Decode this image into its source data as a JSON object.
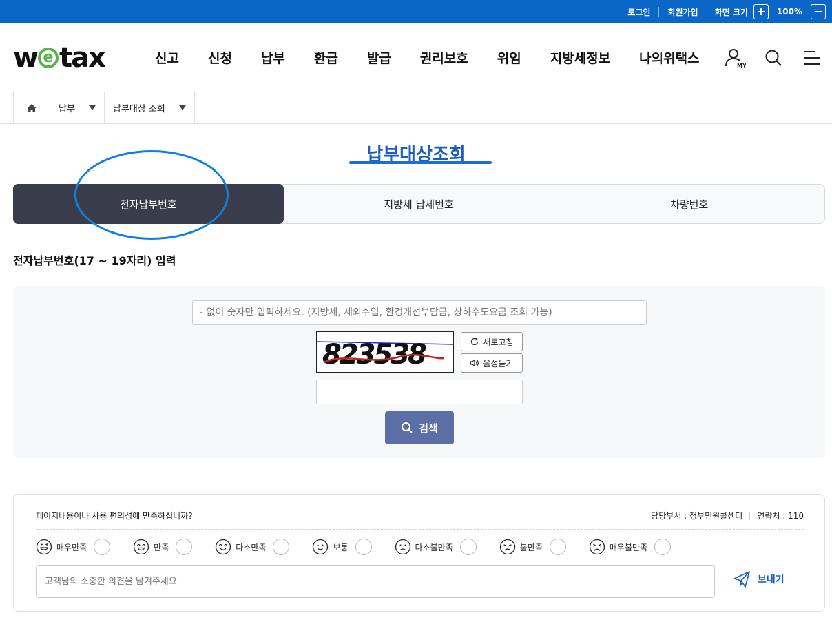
{
  "topbar": {
    "login": "로그인",
    "signup": "회원가입",
    "zoom_label": "화면 크기",
    "zoom_value": "100%",
    "zoom_in": "+",
    "zoom_out": "−"
  },
  "header": {
    "logo_w": "w",
    "logo_e": "e",
    "logo_rest": "tax",
    "nav": [
      "신고",
      "신청",
      "납부",
      "환급",
      "발급",
      "권리보호",
      "위임",
      "지방세정보",
      "나의위택스"
    ],
    "my_label": "MY"
  },
  "breadcrumb": {
    "level1": "납부",
    "level2": "납부대상 조회"
  },
  "page": {
    "title": "납부대상조회",
    "tabs": [
      "전자납부번호",
      "지방세 납세번호",
      "차량번호"
    ],
    "active_tab": 0,
    "subheading": "전자납부번호(17 ~ 19자리) 입력"
  },
  "form": {
    "number_placeholder": "- 없이 숫자만 입력하세요. (지방세, 세외수입, 환경개선부담금, 상하수도요금 조회 가능)",
    "captcha_text": "823538",
    "refresh_label": "새로고침",
    "audio_label": "음성듣기",
    "search_label": "검색"
  },
  "survey": {
    "question": "페이지내용이나 사용 편의성에 만족하십니까?",
    "dept": "담당부서 : 정부민원콜센터",
    "contact": "연락처 : 110",
    "ratings": [
      "매우만족",
      "만족",
      "다소만족",
      "보통",
      "다소불만족",
      "불만족",
      "매우불만족"
    ],
    "opinion_placeholder": "고객님의 소중한 의견을 남겨주세요",
    "send_label": "보내기"
  },
  "colors": {
    "topbar": "#0a67c7",
    "active_tab": "#393c4b",
    "search_button": "#5b6ea5",
    "title": "#1a5fbf",
    "annotation_circle": "#1080e0"
  }
}
